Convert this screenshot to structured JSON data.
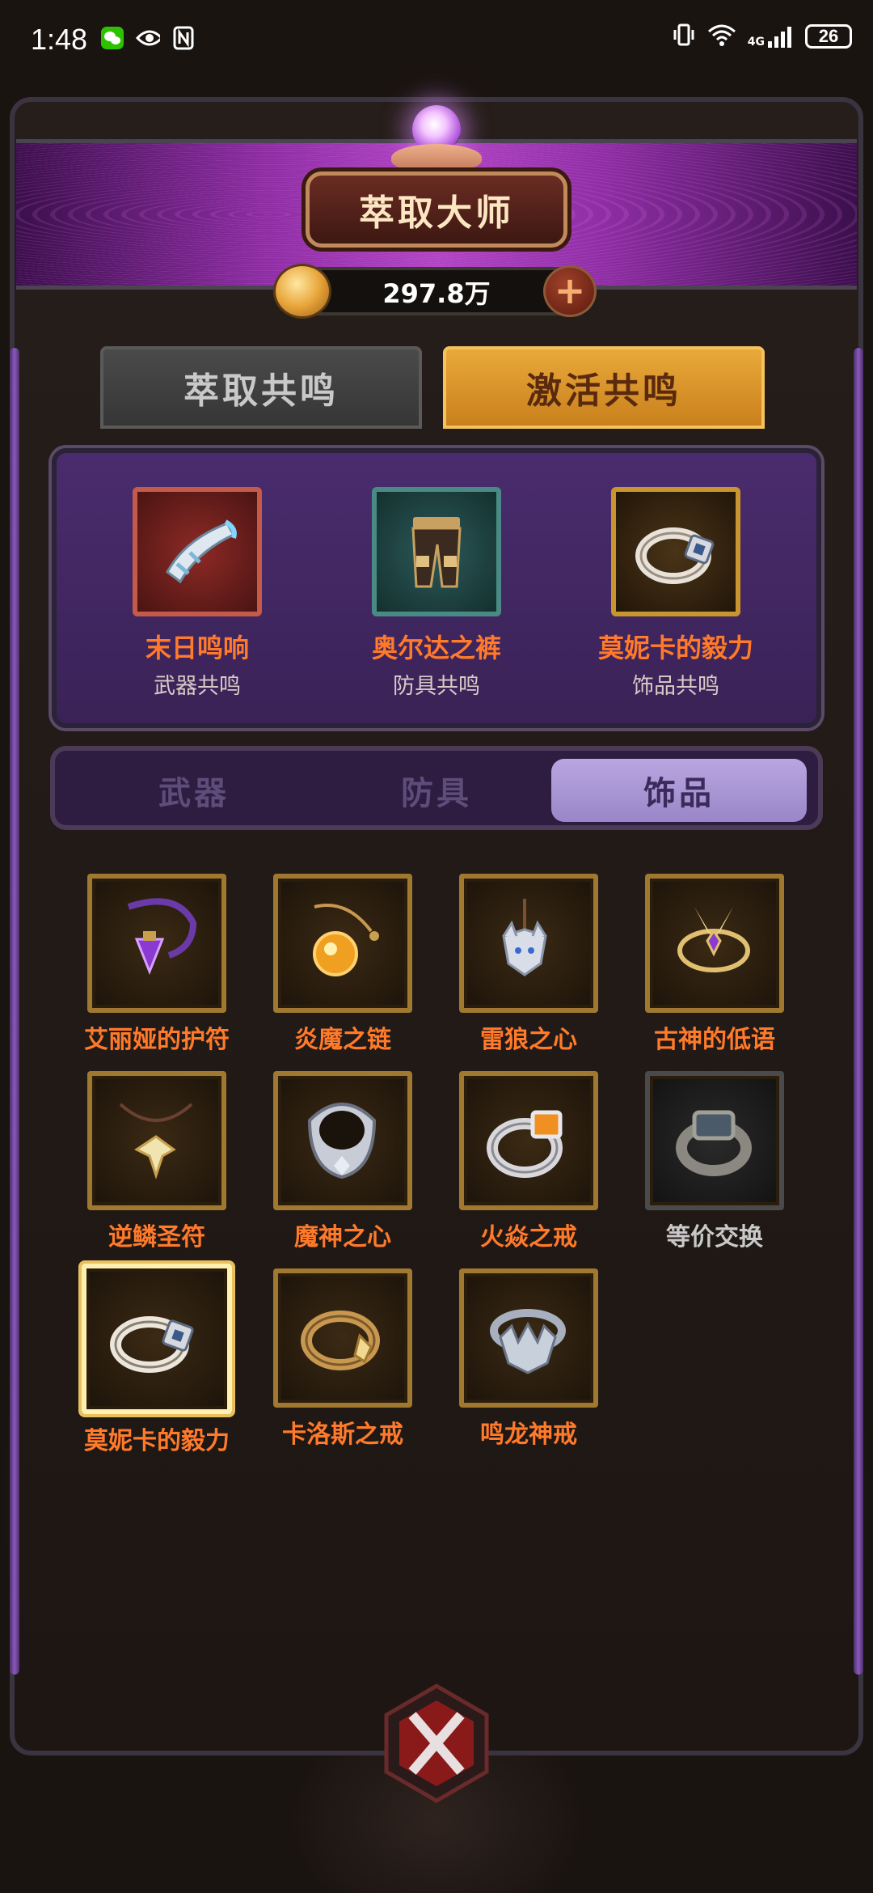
{
  "status_bar": {
    "time": "1:48",
    "network_label": "4G",
    "battery": "26"
  },
  "header": {
    "title": "萃取大师",
    "coins": "297.8万"
  },
  "main_tabs": [
    {
      "label": "萃取共鸣",
      "active": false
    },
    {
      "label": "激活共鸣",
      "active": true
    }
  ],
  "resonance": [
    {
      "name": "末日鸣响",
      "type": "武器共鸣",
      "icon": "horn-icon"
    },
    {
      "name": "奥尔达之裤",
      "type": "防具共鸣",
      "icon": "pants-icon"
    },
    {
      "name": "莫妮卡的毅力",
      "type": "饰品共鸣",
      "icon": "ring-icon"
    }
  ],
  "category_tabs": [
    {
      "label": "武器",
      "active": false
    },
    {
      "label": "防具",
      "active": false
    },
    {
      "label": "饰品",
      "active": true
    }
  ],
  "items": [
    {
      "name": "艾丽娅的护符",
      "icon": "purple-amulet-icon",
      "owned": true
    },
    {
      "name": "炎魔之链",
      "icon": "amber-pendant-icon",
      "owned": true
    },
    {
      "name": "雷狼之心",
      "icon": "wolf-pendant-icon",
      "owned": true
    },
    {
      "name": "古神的低语",
      "icon": "winged-circlet-icon",
      "owned": true
    },
    {
      "name": "逆鳞圣符",
      "icon": "scale-pendant-icon",
      "owned": true
    },
    {
      "name": "魔神之心",
      "icon": "silver-collar-icon",
      "owned": true
    },
    {
      "name": "火焱之戒",
      "icon": "fire-ring-icon",
      "owned": true
    },
    {
      "name": "等价交换",
      "icon": "gray-ring-icon",
      "owned": false
    },
    {
      "name": "莫妮卡的毅力",
      "icon": "gem-ring-icon",
      "owned": true,
      "selected": true
    },
    {
      "name": "卡洛斯之戒",
      "icon": "gold-ring-icon",
      "owned": true
    },
    {
      "name": "鸣龙神戒",
      "icon": "dragon-ring-icon",
      "owned": true
    }
  ],
  "colors": {
    "item_label": "#ff7a2a",
    "active_tab": "#e9a93a",
    "segment_active": "#b9a6e0"
  }
}
